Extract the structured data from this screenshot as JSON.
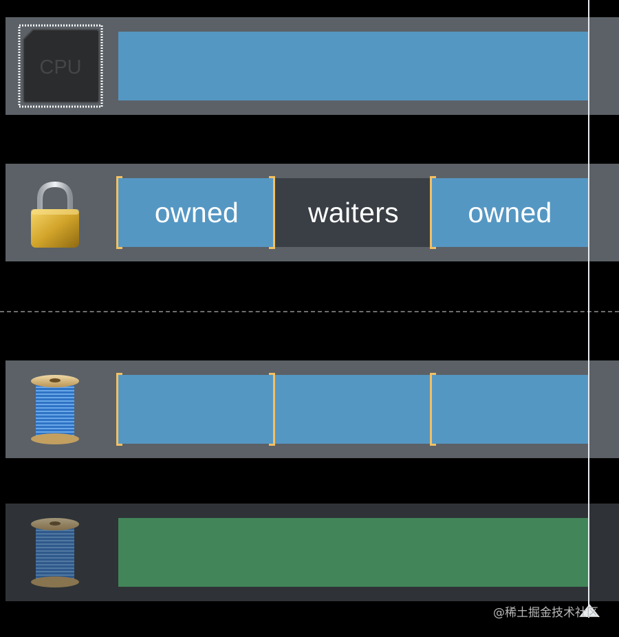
{
  "lanes": [
    {
      "id": "cpu",
      "icon": "cpu-chip-icon",
      "icon_text": "CPU",
      "bar_color": "#5597c3",
      "segments": []
    },
    {
      "id": "lock",
      "icon": "padlock-icon",
      "bar_color": "#5597c3",
      "segments": [
        {
          "label": "owned",
          "state": "owned"
        },
        {
          "label": "waiters",
          "state": "waiters"
        },
        {
          "label": "owned",
          "state": "owned"
        }
      ]
    },
    {
      "id": "thread-1",
      "icon": "thread-spool-icon",
      "bar_color": "#5597c3",
      "segments": [
        {
          "label": "",
          "state": "running"
        },
        {
          "label": "",
          "state": "running"
        },
        {
          "label": "",
          "state": "running"
        }
      ]
    },
    {
      "id": "thread-2",
      "icon": "thread-spool-dim-icon",
      "bar_color": "#428559",
      "segments": []
    }
  ],
  "colors": {
    "lane_bg": "#5b6167",
    "lane_bg_dark": "#2f3337",
    "owned_bar": "#5597c3",
    "waiters_bar": "#3a3f45",
    "green_bar": "#428559",
    "bracket": "#f2c063",
    "playhead": "#e9ecef"
  },
  "watermark": "@稀土掘金技术社区"
}
